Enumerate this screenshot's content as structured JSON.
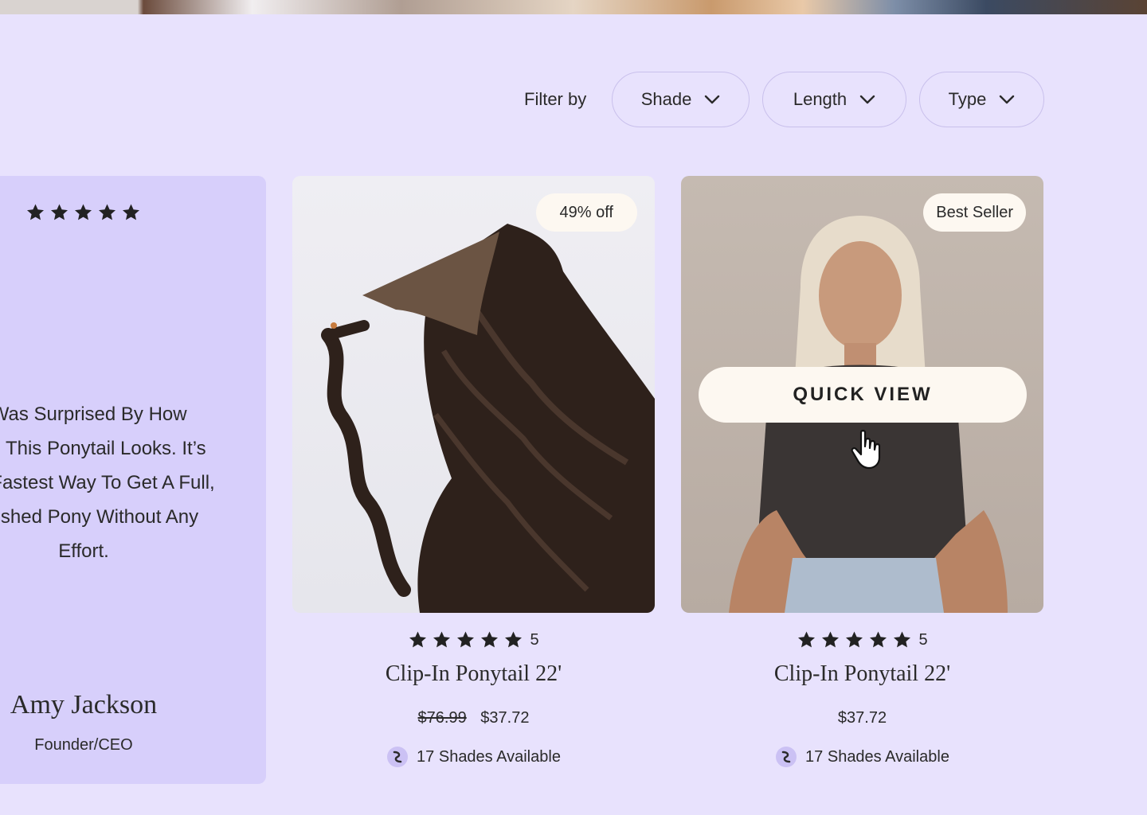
{
  "filter": {
    "label": "Filter by",
    "options": [
      {
        "label": "Shade"
      },
      {
        "label": "Length"
      },
      {
        "label": "Type"
      }
    ]
  },
  "testimonial": {
    "rating": 5,
    "quote_lines": [
      "I Was Surprised By How",
      "Real This Ponytail Looks. It’s",
      "The Fastest Way To Get A Full,",
      "Polished Pony Without Any",
      "Effort."
    ],
    "name": "Amy Jackson",
    "role": "Founder/CEO"
  },
  "products": [
    {
      "badge": "49% off",
      "rating": "5",
      "title": "Clip-In Ponytail 22'",
      "old_price": "$76.99",
      "price": "$37.72",
      "shades": "17 Shades Available",
      "image_icon": "ponytail-product-photo"
    },
    {
      "badge": "Best Seller",
      "quick_view": "QUICK VIEW",
      "rating": "5",
      "title": "Clip-In Ponytail 22'",
      "price": "$37.72",
      "shades": "17 Shades Available",
      "image_icon": "model-photo"
    }
  ],
  "colors": {
    "page_bg": "#e8e2fd",
    "testimonial_bg": "#d7cffb",
    "badge_bg": "#fdf8f1",
    "text": "#2a2a2a"
  }
}
